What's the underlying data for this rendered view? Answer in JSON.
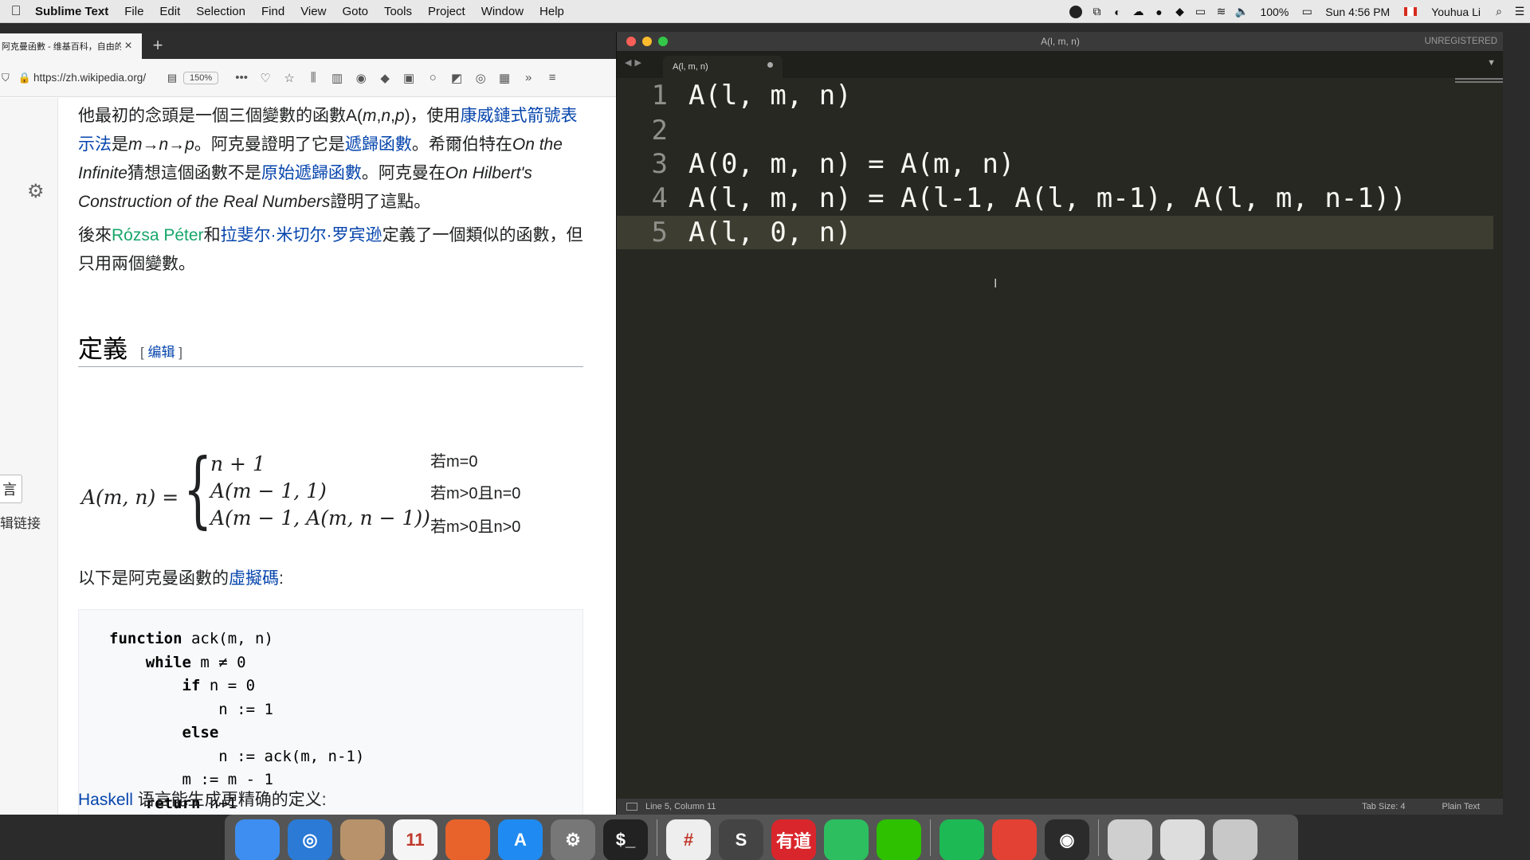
{
  "menubar": {
    "app_name": "Sublime Text",
    "items": [
      "File",
      "Edit",
      "Selection",
      "Find",
      "View",
      "Goto",
      "Tools",
      "Project",
      "Window",
      "Help"
    ],
    "battery": "100%",
    "clock": "Sun 4:56 PM",
    "user": "Youhua Li"
  },
  "browser": {
    "tab_title": "阿克曼函數 - 维基百科，自由的百科全书",
    "url": "https://zh.wikipedia.org/",
    "zoom": "150%",
    "sidebar": {
      "lang_button": "言",
      "lang_link": "辑链接"
    },
    "article": {
      "p1": {
        "t1": "他最初的念頭是一個三個變數的函數A(",
        "i1": "m",
        "t2": ",",
        "i2": "n",
        "t3": ",",
        "i3": "p",
        "t4": ")，使用",
        "link1": "康威鏈式箭號表示法",
        "t5": "是",
        "i4": "m→n→p",
        "t6": "。阿克曼證明了它是",
        "link2": "遞歸函數",
        "t7": "。希爾伯特在",
        "i5": "On the Infinite",
        "t8": "猜想這個函數不是",
        "link3": "原始遞歸函數",
        "t9": "。阿克曼在",
        "i6": "On Hilbert's Construction of the Real Numbers",
        "t10": "證明了這點。"
      },
      "p2": {
        "t1": "後來",
        "link1": "Rózsa Péter",
        "t2": "和",
        "link2": "拉斐尔·米切尔·罗宾逊",
        "t3": "定義了一個類似的函數，但只用兩個變數。"
      },
      "section_title": "定義",
      "edit_open": "[",
      "edit_label": "编辑",
      "edit_close": "]",
      "formula": {
        "lhs": "A(m, n) =",
        "cases": [
          "n + 1",
          "A(m − 1, 1)",
          "A(m − 1, A(m, n − 1))"
        ],
        "conditions": [
          "若m=0",
          "若m>0且n=0",
          "若m>0且n>0"
        ]
      },
      "pseudo_intro": "以下是阿克曼函數的",
      "pseudo_link": "虛擬碼",
      "pseudo_colon": ":",
      "code": [
        {
          "kw": "function",
          "rest": " ack(m, n)",
          "indent": ""
        },
        {
          "kw": "while",
          "rest": " m ≠ 0",
          "indent": "    "
        },
        {
          "kw": "if",
          "rest": " n = 0",
          "indent": "        "
        },
        {
          "kw": "",
          "rest": "n := 1",
          "indent": "            "
        },
        {
          "kw": "else",
          "rest": "",
          "indent": "        "
        },
        {
          "kw": "",
          "rest": "n := ack(m, n-1)",
          "indent": "            "
        },
        {
          "kw": "",
          "rest": "m := m - 1",
          "indent": "        "
        },
        {
          "kw": "return",
          "rest": " n+1",
          "indent": "    "
        }
      ],
      "haskell_link": "Haskell",
      "haskell_text": " 语言能生成更精确的定义:"
    }
  },
  "sublime": {
    "window_title": "A(l, m, n)",
    "unregistered": "UNREGISTERED",
    "tab_label": "A(l, m, n)",
    "lines": [
      {
        "num": "1",
        "text": "A(l, m, n)"
      },
      {
        "num": "2",
        "text": ""
      },
      {
        "num": "3",
        "text": "A(0, m, n) = A(m, n)"
      },
      {
        "num": "4",
        "text": "A(l, m, n) = A(l-1, A(l, m-1), A(l, m, n-1))"
      },
      {
        "num": "5",
        "text": "A(l, 0, n)"
      }
    ],
    "status_position": "Line 5, Column 11",
    "status_tab_size": "Tab Size: 4",
    "status_syntax": "Plain Text"
  },
  "dock": {
    "apps": [
      {
        "name": "finder-icon",
        "color": "#3d8ef0",
        "glyph": ""
      },
      {
        "name": "safari-icon",
        "color": "#2a7ad6",
        "glyph": "◎"
      },
      {
        "name": "contacts-icon",
        "color": "#b8926a",
        "glyph": ""
      },
      {
        "name": "calendar-icon",
        "color": "#f5f5f5",
        "glyph": "11"
      },
      {
        "name": "firefox-icon",
        "color": "#e8632b",
        "glyph": ""
      },
      {
        "name": "app-store-icon",
        "color": "#1f8bf2",
        "glyph": "A"
      },
      {
        "name": "system-preferences-icon",
        "color": "#777777",
        "glyph": "⚙"
      },
      {
        "name": "terminal-icon",
        "color": "#222222",
        "glyph": "$_"
      },
      {
        "name": "slack-icon",
        "color": "#eeeeee",
        "glyph": "#"
      },
      {
        "name": "sublime-text-icon",
        "color": "#444444",
        "glyph": "S"
      },
      {
        "name": "youdao-icon",
        "color": "#d9262c",
        "glyph": "有道"
      },
      {
        "name": "evernote-icon",
        "color": "#2dbe60",
        "glyph": ""
      },
      {
        "name": "wechat-icon",
        "color": "#2dc100",
        "glyph": ""
      },
      {
        "name": "spotify-icon",
        "color": "#1db954",
        "glyph": ""
      },
      {
        "name": "chrome-icon",
        "color": "#e34133",
        "glyph": ""
      },
      {
        "name": "obs-icon",
        "color": "#2b2b2b",
        "glyph": "◉"
      },
      {
        "name": "preview-icon",
        "color": "#cfcfcf",
        "glyph": ""
      },
      {
        "name": "finder-window-icon",
        "color": "#dddddd",
        "glyph": ""
      },
      {
        "name": "trash-icon",
        "color": "#c8c8c8",
        "glyph": ""
      }
    ]
  }
}
